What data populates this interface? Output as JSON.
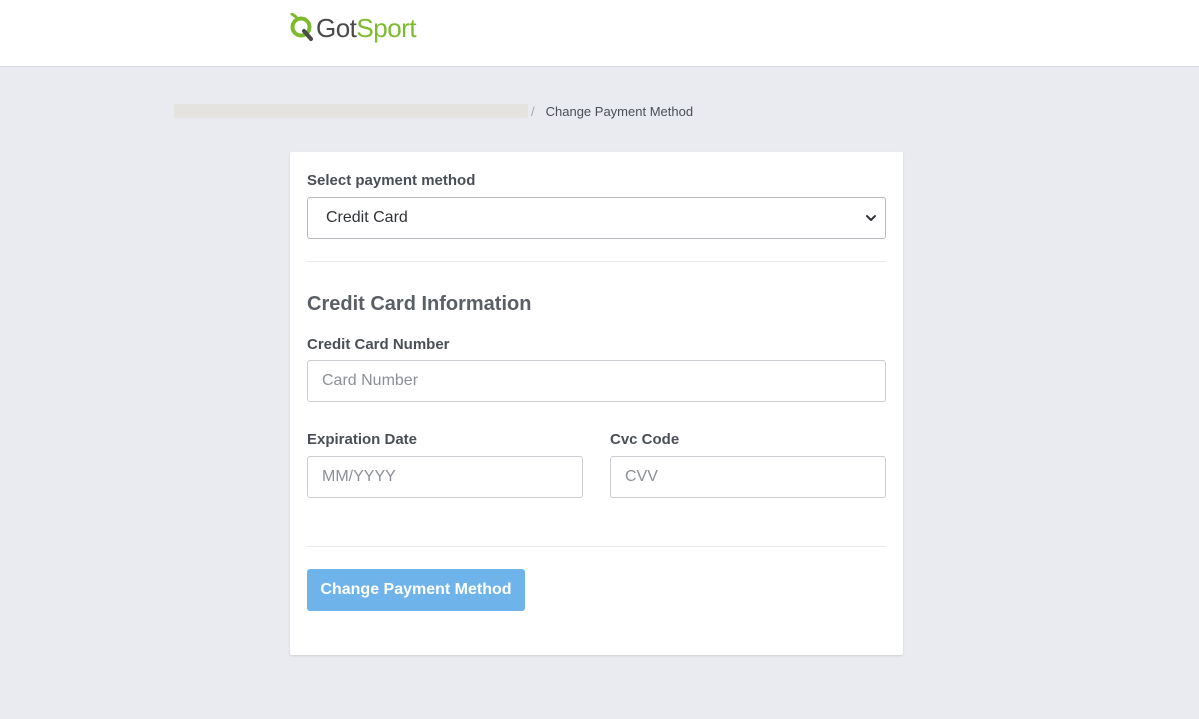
{
  "header": {
    "logo_got": "Got",
    "logo_sport": "Sport",
    "colors": {
      "brand_green": "#7dbb2e",
      "brand_gray": "#4a4a4a"
    }
  },
  "breadcrumb": {
    "separator": "/",
    "current": "Change Payment Method"
  },
  "form": {
    "payment_method_label": "Select payment method",
    "payment_method_value": "Credit Card",
    "section_title": "Credit Card Information",
    "card_number_label": "Credit Card Number",
    "card_number_placeholder": "Card Number",
    "expiration_label": "Expiration Date",
    "expiration_placeholder": "MM/YYYY",
    "cvc_label": "Cvc Code",
    "cvc_placeholder": "CVV",
    "submit_label": "Change Payment Method",
    "colors": {
      "button_bg": "#6fb3eb"
    }
  }
}
